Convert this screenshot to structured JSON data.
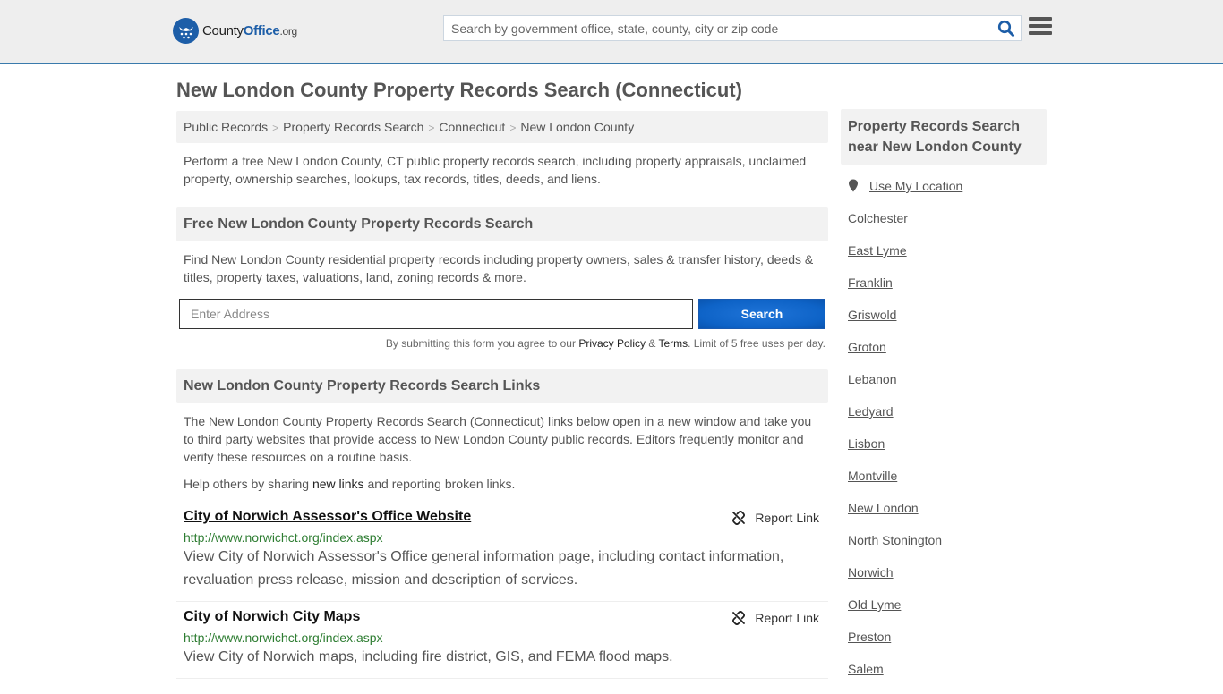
{
  "header": {
    "logo_text_county": "County",
    "logo_text_office": "Office",
    "logo_text_org": ".org",
    "search_placeholder": "Search by government office, state, county, city or zip code",
    "search_value": "",
    "icons": {
      "search": "search-icon",
      "menu": "hamburger-menu-icon",
      "logo": "eagle-stars-logo-icon"
    }
  },
  "page_title": "New London County Property Records Search (Connecticut)",
  "breadcrumb": [
    {
      "label": "Public Records"
    },
    {
      "label": "Property Records Search"
    },
    {
      "label": "Connecticut"
    },
    {
      "label": "New London County"
    }
  ],
  "breadcrumb_separator": ">",
  "intro": "Perform a free New London County, CT public property records search, including property appraisals, unclaimed property, ownership searches, lookups, tax records, titles, deeds, and liens.",
  "search_section": {
    "heading": "Free New London County Property Records Search",
    "description": "Find New London County residential property records including property owners, sales & transfer history, deeds & titles, property taxes, valuations, land, zoning records & more.",
    "address_placeholder": "Enter Address",
    "address_value": "",
    "button_label": "Search",
    "disclaimer_prefix": "By submitting this form you agree to our ",
    "privacy_label": "Privacy Policy",
    "amp": " & ",
    "terms_label": "Terms",
    "disclaimer_suffix": ". Limit of 5 free uses per day."
  },
  "links_section": {
    "heading": "New London County Property Records Search Links",
    "description": "The New London County Property Records Search (Connecticut) links below open in a new window and take you to third party websites that provide access to New London County public records. Editors frequently monitor and verify these resources on a routine basis.",
    "help_prefix": "Help others by sharing ",
    "help_link": "new links",
    "help_suffix": " and reporting broken links.",
    "report_label": "Report Link",
    "items": [
      {
        "title": "City of Norwich Assessor's Office Website",
        "url": "http://www.norwichct.org/index.aspx",
        "description": "View City of Norwich Assessor's Office general information page, including contact information, revaluation press release, mission and description of services."
      },
      {
        "title": "City of Norwich City Maps",
        "url": "http://www.norwichct.org/index.aspx",
        "description": "View City of Norwich maps, including fire district, GIS, and FEMA flood maps."
      }
    ]
  },
  "sidebar": {
    "heading": "Property Records Search near New London County",
    "use_location": "Use My Location",
    "places": [
      "Colchester",
      "East Lyme",
      "Franklin",
      "Griswold",
      "Groton",
      "Lebanon",
      "Ledyard",
      "Lisbon",
      "Montville",
      "New London",
      "North Stonington",
      "Norwich",
      "Old Lyme",
      "Preston",
      "Salem"
    ]
  },
  "colors": {
    "brand_blue": "#1d5ea8",
    "header_border": "#3a7aac",
    "button_blue": "#0e63c7",
    "url_green": "#2e7d32"
  }
}
